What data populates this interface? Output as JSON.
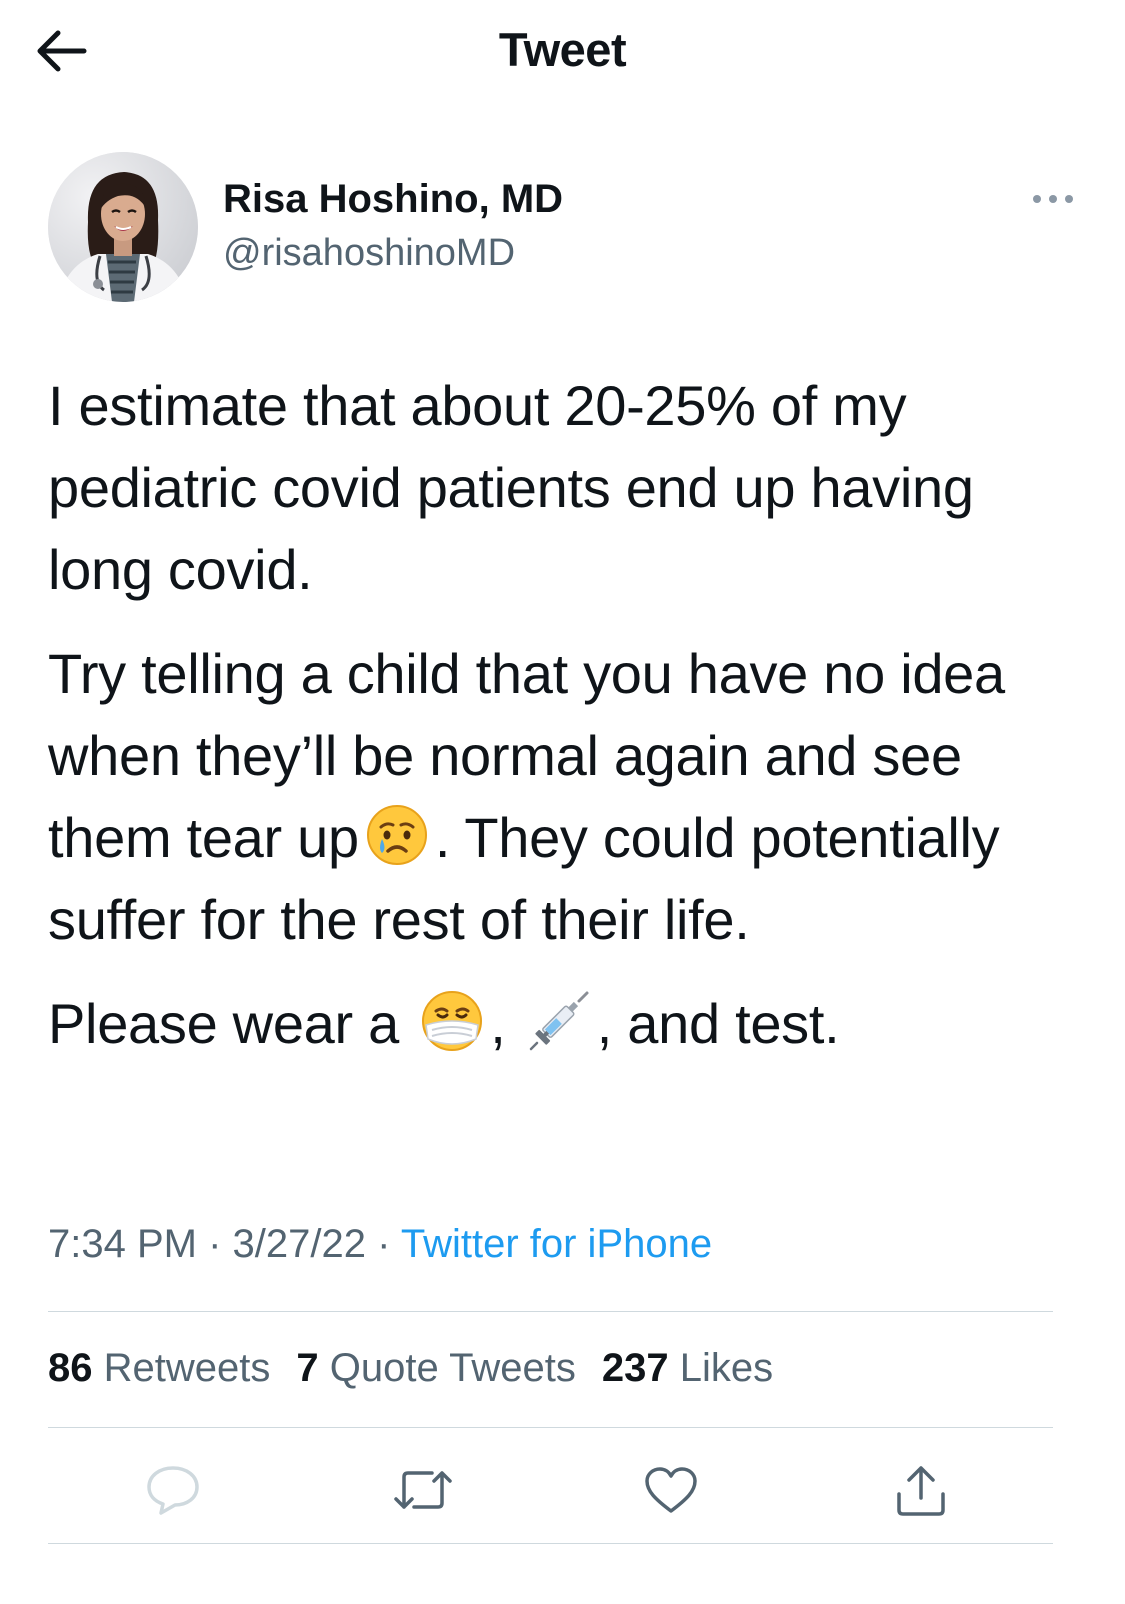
{
  "header": {
    "title": "Tweet",
    "back_icon": "arrow-left-icon"
  },
  "author": {
    "display_name": "Risa Hoshino, MD",
    "handle": "@risahoshinoMD",
    "more_icon": "more-horizontal-icon"
  },
  "tweet": {
    "paragraph1": "I estimate that about 20-25% of my pediatric covid patients end up having long covid.",
    "paragraph2_part1": "Try telling a child that you have no idea when they’ll be normal again and see them tear up",
    "paragraph2_part2": ". They could potentially suffer for the rest of their life.",
    "paragraph3_part1": "Please wear a",
    "paragraph3_part2": ",",
    "paragraph3_part3": ", and test.",
    "emojis": [
      "crying-face-emoji",
      "medical-mask-face-emoji",
      "syringe-emoji"
    ]
  },
  "meta": {
    "time": "7:34 PM",
    "separator": "·",
    "date": "3/27/22",
    "source": "Twitter for iPhone"
  },
  "stats": {
    "retweets_count": "86",
    "retweets_label": "Retweets",
    "quotes_count": "7",
    "quotes_label": "Quote Tweets",
    "likes_count": "237",
    "likes_label": "Likes"
  },
  "actions": {
    "reply_icon": "reply-icon",
    "retweet_icon": "retweet-icon",
    "like_icon": "heart-icon",
    "share_icon": "share-icon"
  },
  "colors": {
    "text": "#0f1419",
    "secondary": "#536471",
    "link": "#1d9bf0",
    "divider": "#cfd9de"
  }
}
